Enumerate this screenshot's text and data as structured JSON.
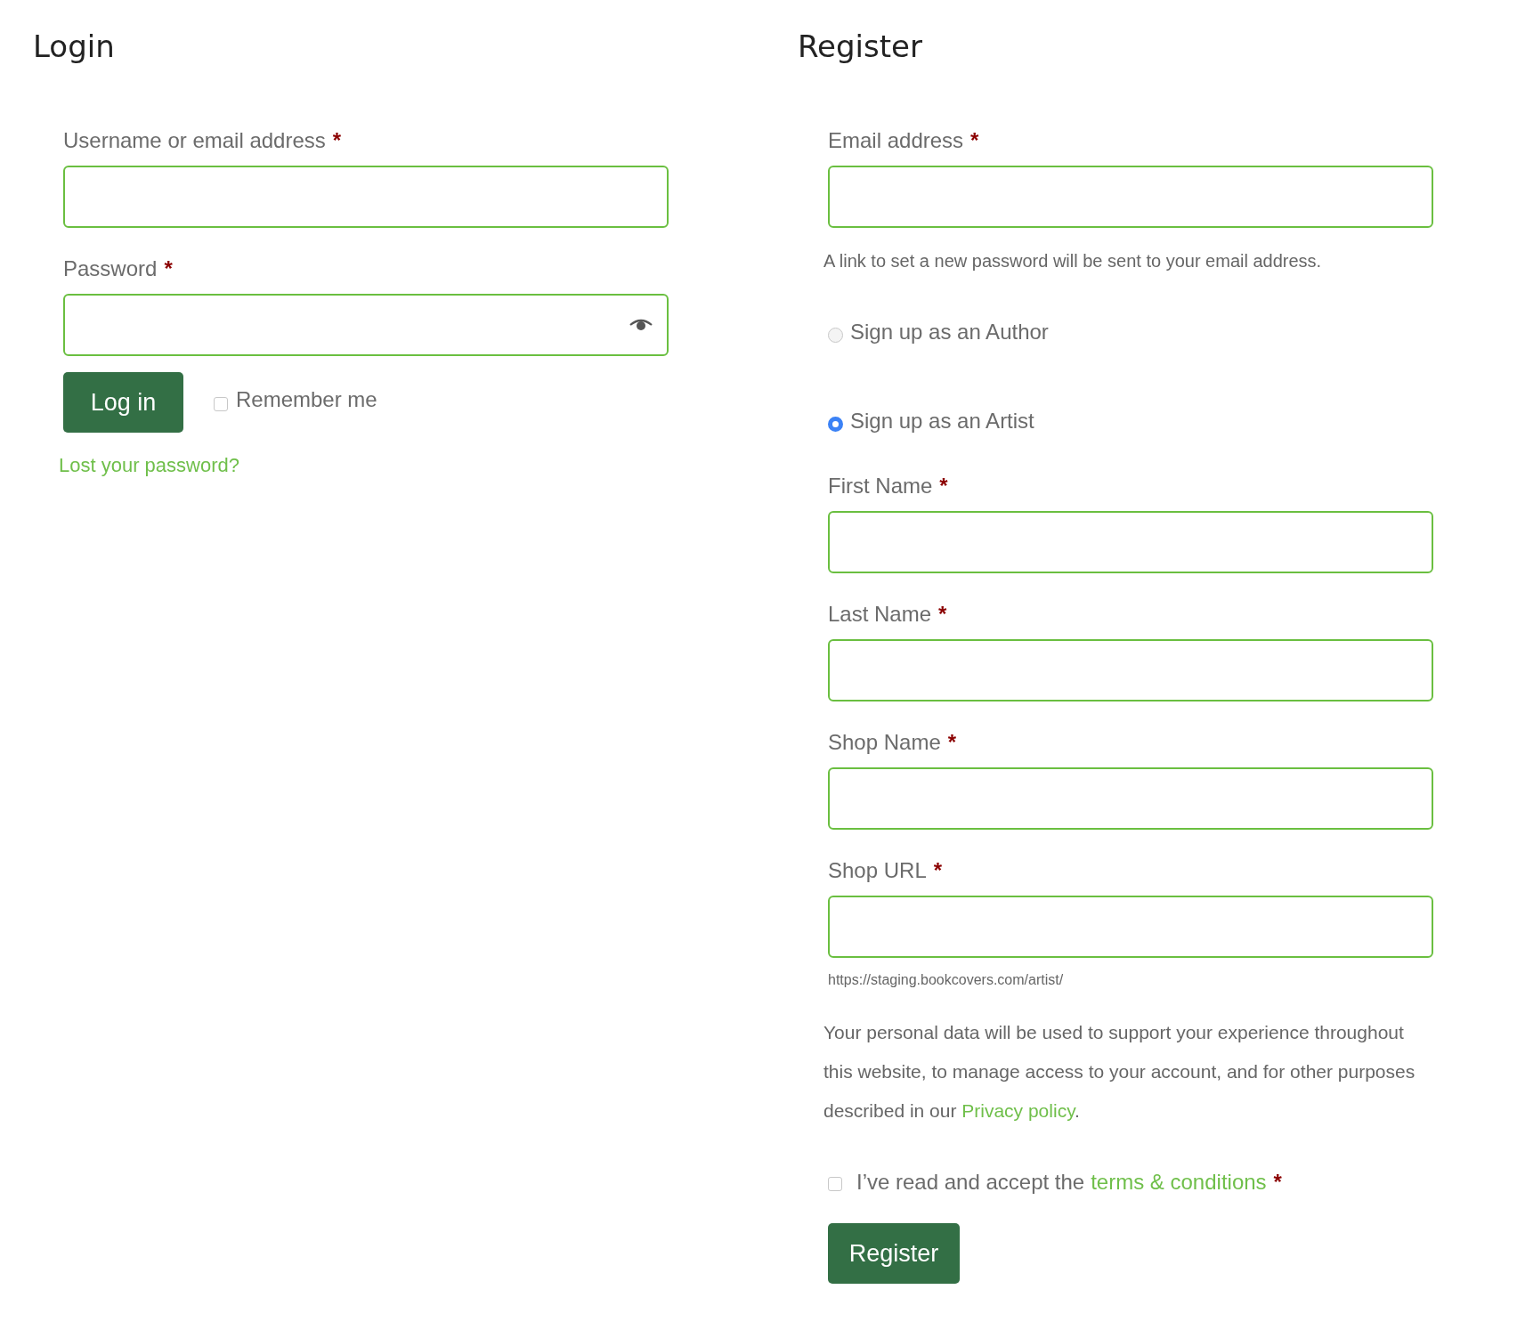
{
  "login": {
    "title": "Login",
    "fields": [
      {
        "label": "Username or email address",
        "required_mark": "*",
        "kind": "text"
      },
      {
        "label": "Password",
        "required_mark": "*",
        "kind": "password"
      }
    ],
    "submit": "Log in",
    "remember": {
      "label": "Remember me",
      "checked": false
    },
    "lost_password": "Lost your password?"
  },
  "register": {
    "title": "Register",
    "email_field": {
      "label": "Email address",
      "required_mark": "*"
    },
    "email_note": "A link to set a new password will be sent to your email address.",
    "roles": [
      {
        "label": "Sign up as an Author",
        "selected": false
      },
      {
        "label": "Sign up as an Artist",
        "selected": true
      }
    ],
    "fields": [
      {
        "label": "First Name",
        "required_mark": "*"
      },
      {
        "label": "Last Name",
        "required_mark": "*"
      },
      {
        "label": "Shop Name",
        "required_mark": "*"
      },
      {
        "label": "Shop URL",
        "required_mark": "*"
      }
    ],
    "shop_url_hint": "https://staging.bookcovers.com/artist/",
    "privacy": {
      "text_before": "Your personal data will be used to support your experience throughout this website, to manage access to your account, and for other purposes described in our ",
      "link": "Privacy policy",
      "text_after": "."
    },
    "terms": {
      "label": "I’ve read and accept the",
      "link": "terms & conditions",
      "required_mark": "*",
      "checked": false
    },
    "submit": "Register"
  }
}
